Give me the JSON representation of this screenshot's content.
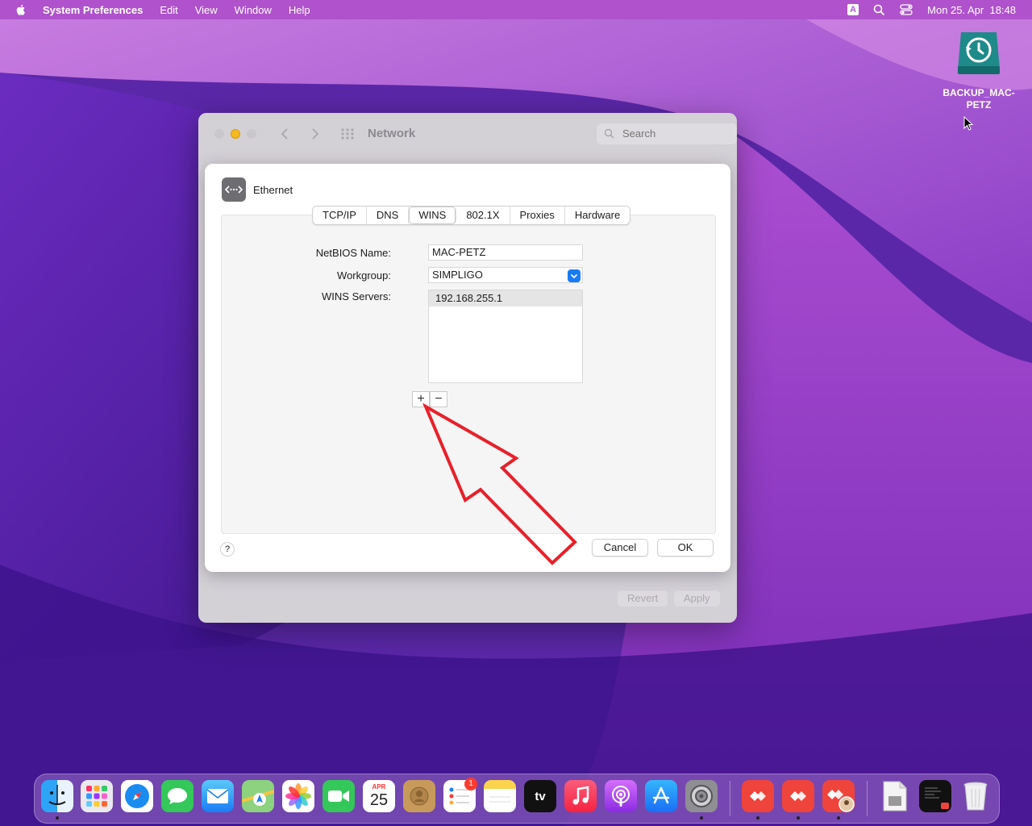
{
  "menubar": {
    "app_name": "System Preferences",
    "menus": [
      "Edit",
      "View",
      "Window",
      "Help"
    ],
    "input_badge": "A",
    "clock": "Mon 25. Apr  18:48"
  },
  "desktop_icon": {
    "label_line1": "BACKUP_MAC-",
    "label_line2": "PETZ"
  },
  "window": {
    "title": "Network",
    "search_placeholder": "Search",
    "revert_label": "Revert",
    "apply_label": "Apply"
  },
  "sheet": {
    "interface_name": "Ethernet",
    "tabs": [
      "TCP/IP",
      "DNS",
      "WINS",
      "802.1X",
      "Proxies",
      "Hardware"
    ],
    "active_tab": "WINS",
    "netbios_label": "NetBIOS Name:",
    "netbios_value": "MAC-PETZ",
    "workgroup_label": "Workgroup:",
    "workgroup_value": "SIMPLIGO",
    "wins_label": "WINS Servers:",
    "wins_servers": [
      "192.168.255.1"
    ],
    "add_label": "+",
    "remove_label": "−",
    "help_label": "?",
    "cancel_label": "Cancel",
    "ok_label": "OK"
  },
  "dock": {
    "calendar_month": "APR",
    "calendar_day": "25",
    "reminders_badge": "1",
    "tv_label": "tv",
    "items": [
      "finder",
      "launchpad",
      "safari",
      "messages",
      "mail",
      "maps",
      "photos",
      "facetime",
      "calendar",
      "contacts",
      "reminders",
      "notes",
      "apple-tv",
      "music",
      "podcasts",
      "app-store",
      "system-preferences",
      "anydesk-1",
      "anydesk-2",
      "anydesk-3",
      "document",
      "terminal-window",
      "trash"
    ]
  },
  "colors": {
    "accent": "#1a7cf5",
    "annotation_arrow": "#e8202a",
    "minimize": "#f4b91e"
  }
}
